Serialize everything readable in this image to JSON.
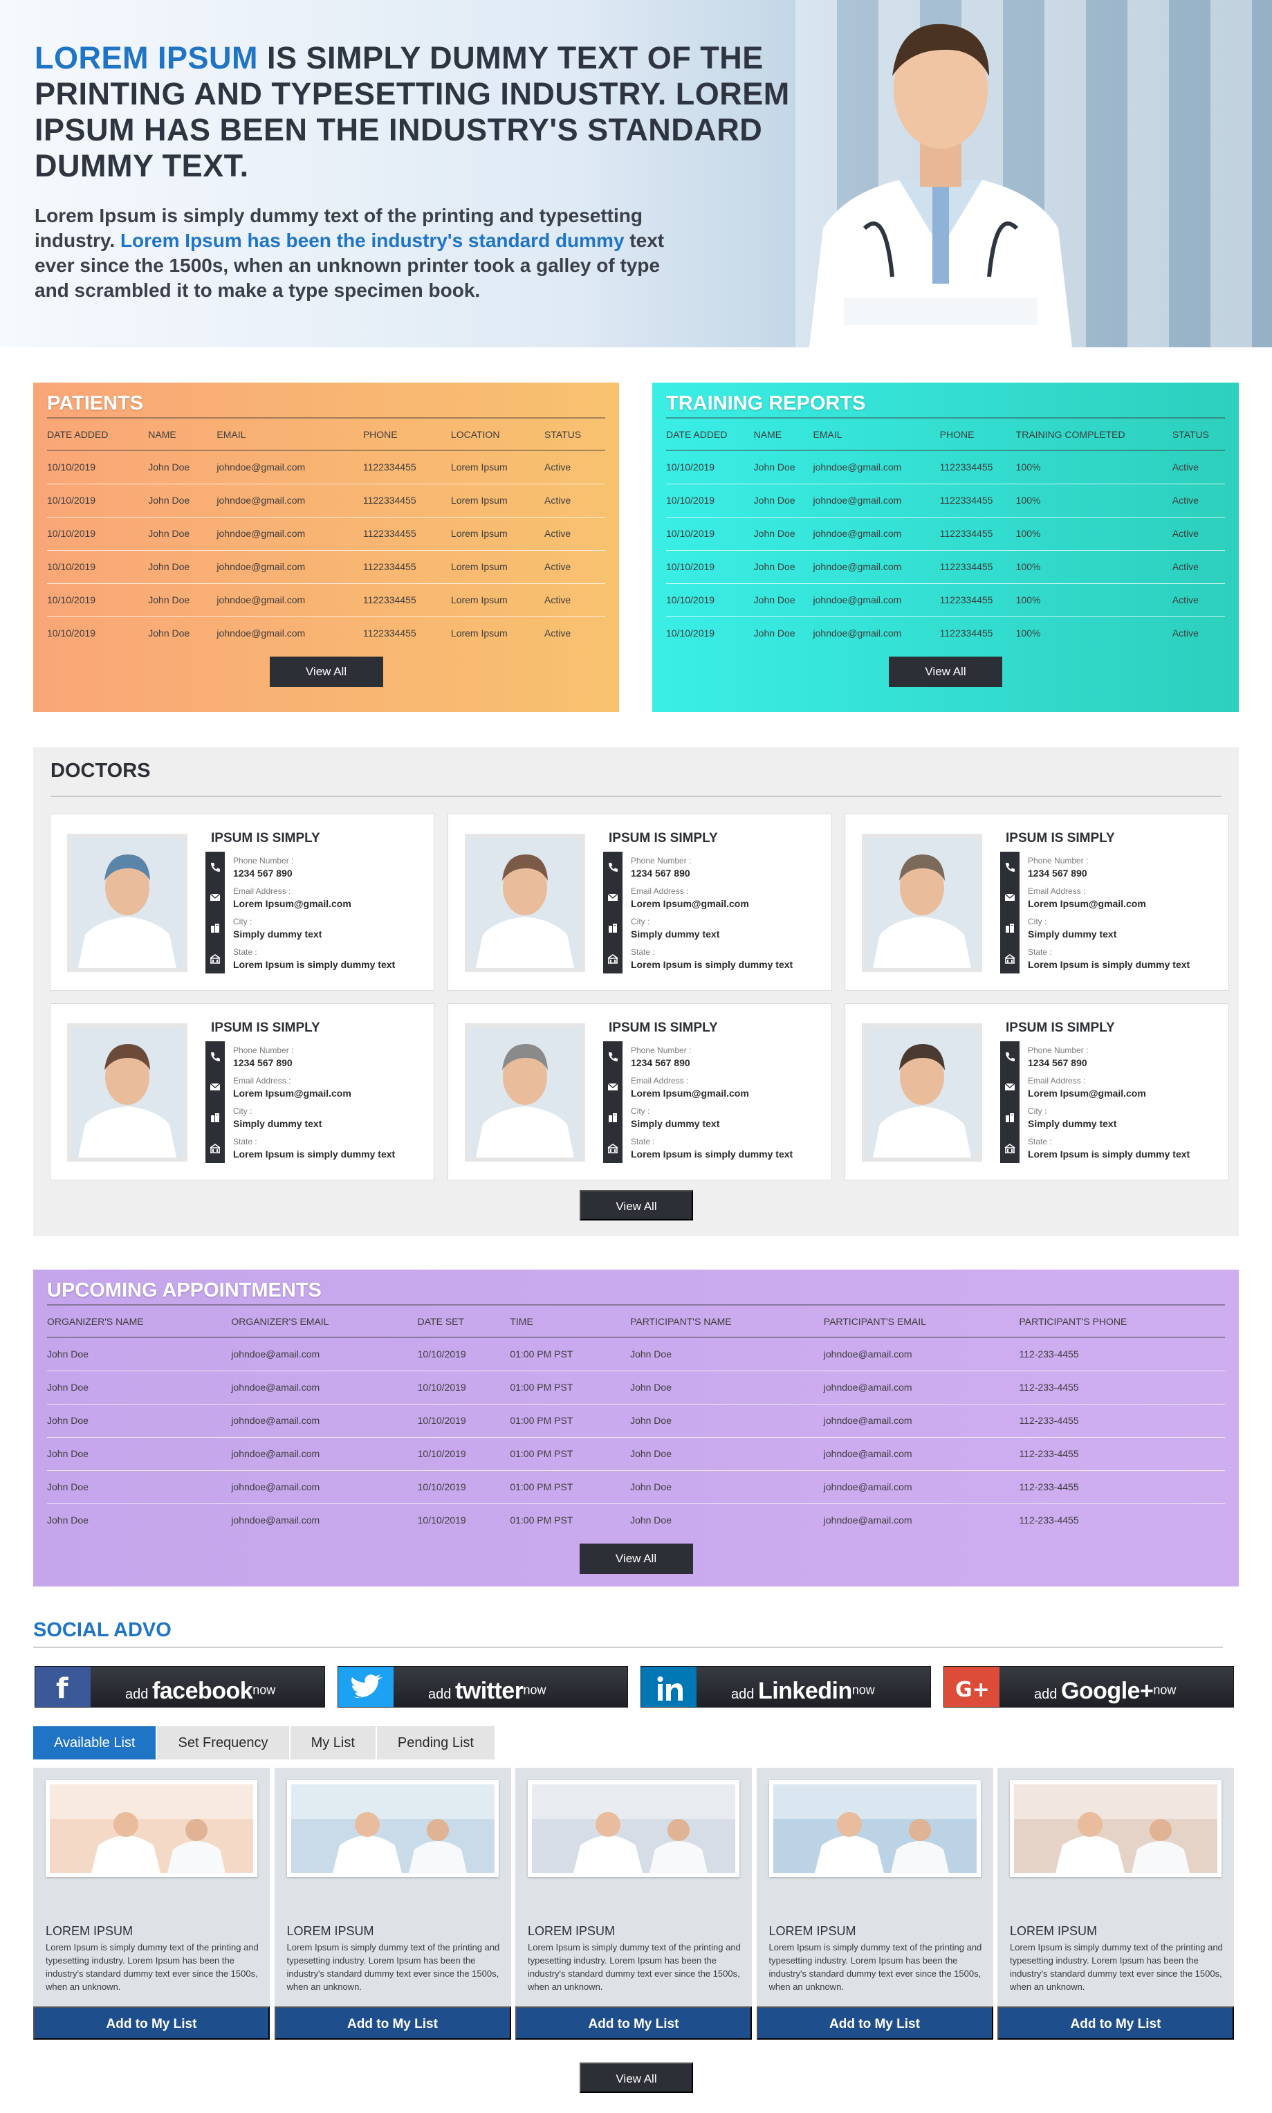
{
  "hero": {
    "headline_accent": "LOREM IPSUM",
    "headline_rest": " IS SIMPLY DUMMY TEXT OF THE PRINTING AND TYPESETTING INDUSTRY. LOREM IPSUM HAS BEEN THE INDUSTRY'S STANDARD DUMMY TEXT.",
    "body_start": "Lorem Ipsum is simply dummy text of the printing and typesetting industry. ",
    "body_accent": "Lorem Ipsum has been the industry's standard dummy",
    "body_end": " text ever since the 1500s, when an unknown printer took a galley of type and scrambled it to make a type specimen book."
  },
  "patients": {
    "title": "PATIENTS",
    "columns": [
      "DATE ADDED",
      "NAME",
      "EMAIL",
      "PHONE",
      "LOCATION",
      "STATUS"
    ],
    "rows": [
      [
        "10/10/2019",
        "John Doe",
        "johndoe@gmail.com",
        "1122334455",
        "Lorem Ipsum",
        "Active"
      ],
      [
        "10/10/2019",
        "John Doe",
        "johndoe@gmail.com",
        "1122334455",
        "Lorem Ipsum",
        "Active"
      ],
      [
        "10/10/2019",
        "John Doe",
        "johndoe@gmail.com",
        "1122334455",
        "Lorem Ipsum",
        "Active"
      ],
      [
        "10/10/2019",
        "John Doe",
        "johndoe@gmail.com",
        "1122334455",
        "Lorem Ipsum",
        "Active"
      ],
      [
        "10/10/2019",
        "John Doe",
        "johndoe@gmail.com",
        "1122334455",
        "Lorem Ipsum",
        "Active"
      ],
      [
        "10/10/2019",
        "John Doe",
        "johndoe@gmail.com",
        "1122334455",
        "Lorem Ipsum",
        "Active"
      ]
    ],
    "view_all": "View All"
  },
  "training": {
    "title": "TRAINING REPORTS",
    "columns": [
      "DATE ADDED",
      "NAME",
      "EMAIL",
      "PHONE",
      "TRAINING COMPLETED",
      "STATUS"
    ],
    "rows": [
      [
        "10/10/2019",
        "John Doe",
        "johndoe@gmail.com",
        "1122334455",
        "100%",
        "Active"
      ],
      [
        "10/10/2019",
        "John Doe",
        "johndoe@gmail.com",
        "1122334455",
        "100%",
        "Active"
      ],
      [
        "10/10/2019",
        "John Doe",
        "johndoe@gmail.com",
        "1122334455",
        "100%",
        "Active"
      ],
      [
        "10/10/2019",
        "John Doe",
        "johndoe@gmail.com",
        "1122334455",
        "100%",
        "Active"
      ],
      [
        "10/10/2019",
        "John Doe",
        "johndoe@gmail.com",
        "1122334455",
        "100%",
        "Active"
      ],
      [
        "10/10/2019",
        "John Doe",
        "johndoe@gmail.com",
        "1122334455",
        "100%",
        "Active"
      ]
    ],
    "view_all": "View All"
  },
  "doctors": {
    "title": "DOCTORS",
    "view_all": "View All",
    "labels": {
      "phone": "Phone Number :",
      "email": "Email Address :",
      "city": "City :",
      "state": "State :"
    },
    "cards": [
      {
        "name": "IPSUM IS SIMPLY",
        "phone": "1234 567 890",
        "email": "Lorem Ipsum@gmail.com",
        "city": "Simply dummy text",
        "state": "Lorem Ipsum is simply dummy text",
        "photo_color": "#5a84a8"
      },
      {
        "name": "IPSUM IS SIMPLY",
        "phone": "1234 567 890",
        "email": "Lorem Ipsum@gmail.com",
        "city": "Simply dummy text",
        "state": "Lorem Ipsum is simply dummy text",
        "photo_color": "#7c5a48"
      },
      {
        "name": "IPSUM IS SIMPLY",
        "phone": "1234 567 890",
        "email": "Lorem Ipsum@gmail.com",
        "city": "Simply dummy text",
        "state": "Lorem Ipsum is simply dummy text",
        "photo_color": "#7b6a5a"
      },
      {
        "name": "IPSUM IS SIMPLY",
        "phone": "1234 567 890",
        "email": "Lorem Ipsum@gmail.com",
        "city": "Simply dummy text",
        "state": "Lorem Ipsum is simply dummy text",
        "photo_color": "#6b4a3a"
      },
      {
        "name": "IPSUM IS SIMPLY",
        "phone": "1234 567 890",
        "email": "Lorem Ipsum@gmail.com",
        "city": "Simply dummy text",
        "state": "Lorem Ipsum is simply dummy text",
        "photo_color": "#8a8a8a"
      },
      {
        "name": "IPSUM IS SIMPLY",
        "phone": "1234 567 890",
        "email": "Lorem Ipsum@gmail.com",
        "city": "Simply dummy text",
        "state": "Lorem Ipsum is simply dummy text",
        "photo_color": "#4a3a30"
      }
    ]
  },
  "appointments": {
    "title": "UPCOMING APPOINTMENTS",
    "columns": [
      "ORGANIZER'S NAME",
      "ORGANIZER'S EMAIL",
      "DATE SET",
      "TIME",
      "PARTICIPANT'S NAME",
      "PARTICIPANT'S EMAIL",
      "PARTICIPANT'S PHONE"
    ],
    "rows": [
      [
        "John Doe",
        "johndoe@amail.com",
        "10/10/2019",
        "01:00 PM PST",
        "John Doe",
        "johndoe@amail.com",
        "112-233-4455"
      ],
      [
        "John Doe",
        "johndoe@amail.com",
        "10/10/2019",
        "01:00 PM PST",
        "John Doe",
        "johndoe@amail.com",
        "112-233-4455"
      ],
      [
        "John Doe",
        "johndoe@amail.com",
        "10/10/2019",
        "01:00 PM PST",
        "John Doe",
        "johndoe@amail.com",
        "112-233-4455"
      ],
      [
        "John Doe",
        "johndoe@amail.com",
        "10/10/2019",
        "01:00 PM PST",
        "John Doe",
        "johndoe@amail.com",
        "112-233-4455"
      ],
      [
        "John Doe",
        "johndoe@amail.com",
        "10/10/2019",
        "01:00 PM PST",
        "John Doe",
        "johndoe@amail.com",
        "112-233-4455"
      ],
      [
        "John Doe",
        "johndoe@amail.com",
        "10/10/2019",
        "01:00 PM PST",
        "John Doe",
        "johndoe@amail.com",
        "112-233-4455"
      ]
    ],
    "view_all": "View All"
  },
  "social": {
    "title": "SOCIAL ADVO",
    "buttons": [
      {
        "add": "add ",
        "brand": "facebook",
        "now": "now",
        "icon": "facebook-icon",
        "color": "#3b5998"
      },
      {
        "add": "add ",
        "brand": "twitter",
        "now": "now",
        "icon": "twitter-icon",
        "color": "#1da1f2"
      },
      {
        "add": "add ",
        "brand": "Linkedin",
        "now": "now",
        "icon": "linkedin-icon",
        "color": "#0077b5"
      },
      {
        "add": "add ",
        "brand": "Google+",
        "now": "now",
        "icon": "google-plus-icon",
        "color": "#dd4b39"
      }
    ],
    "tabs": [
      "Available List",
      "Set Frequency",
      "My List",
      "Pending List"
    ],
    "active_tab": "Available List",
    "cards": [
      {
        "title": "LOREM IPSUM",
        "desc": "Lorem Ipsum is simply dummy text of the printing and typesetting industry. Lorem Ipsum has been the industry's standard dummy text ever since the 1500s, when an unknown.",
        "button": "Add to My List"
      },
      {
        "title": "LOREM IPSUM",
        "desc": "Lorem Ipsum is simply dummy text of the printing and typesetting industry. Lorem Ipsum has been the industry's standard dummy text ever since the 1500s, when an unknown.",
        "button": "Add to My List"
      },
      {
        "title": "LOREM IPSUM",
        "desc": "Lorem Ipsum is simply dummy text of the printing and typesetting industry. Lorem Ipsum has been the industry's standard dummy text ever since the 1500s, when an unknown.",
        "button": "Add to My List"
      },
      {
        "title": "LOREM IPSUM",
        "desc": "Lorem Ipsum is simply dummy text of the printing and typesetting industry. Lorem Ipsum has been the industry's standard dummy text ever since the 1500s, when an unknown.",
        "button": "Add to My List"
      },
      {
        "title": "LOREM IPSUM",
        "desc": "Lorem Ipsum is simply dummy text of the printing and typesetting industry. Lorem Ipsum has been the industry's standard dummy text ever since the 1500s, when an unknown.",
        "button": "Add to My List"
      }
    ],
    "view_all": "View All"
  },
  "colors": {
    "accent": "#1f74c5",
    "dark_button": "#2d2f36",
    "add_button": "#1f4e8c"
  }
}
